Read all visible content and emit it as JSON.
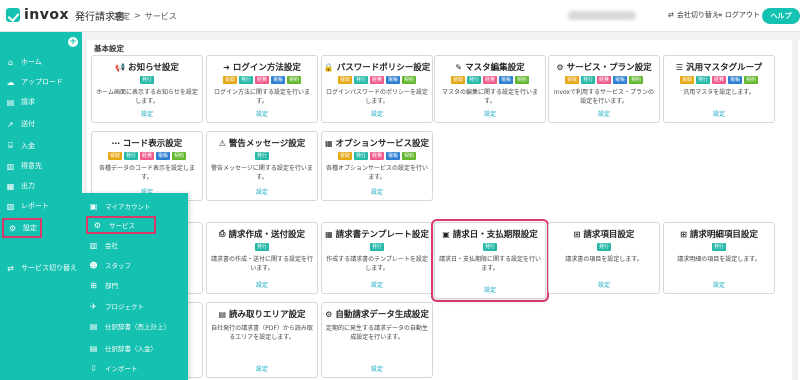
{
  "brand": {
    "name": "invox",
    "product": "発行請求書"
  },
  "breadcrumb": [
    "設定",
    ">",
    "サービス"
  ],
  "header": {
    "switch_company": "会社切り替え",
    "logout": "ログアウト",
    "help": "ヘルプ"
  },
  "colors": {
    "accent": "#15c1b0",
    "highlight": "#d9396b",
    "link": "#15a8c1"
  },
  "sidebar": {
    "items": [
      {
        "label": "ホーム",
        "icon": "home-icon"
      },
      {
        "label": "アップロード",
        "icon": "upload-icon"
      },
      {
        "label": "請求",
        "icon": "document-icon"
      },
      {
        "label": "送付",
        "icon": "send-icon"
      },
      {
        "label": "入金",
        "icon": "bank-icon"
      },
      {
        "label": "得意先",
        "icon": "building-icon"
      },
      {
        "label": "出力",
        "icon": "export-icon"
      },
      {
        "label": "レポート",
        "icon": "report-icon"
      },
      {
        "label": "設定",
        "icon": "gear-icon"
      },
      {
        "label": "サービス切り替え",
        "icon": "switch-icon"
      }
    ]
  },
  "submenu": {
    "items": [
      {
        "label": "マイアカウント",
        "icon": "account-icon"
      },
      {
        "label": "サービス",
        "icon": "gears-icon"
      },
      {
        "label": "会社",
        "icon": "company-icon"
      },
      {
        "label": "スタッフ",
        "icon": "staff-icon"
      },
      {
        "label": "部門",
        "icon": "org-icon"
      },
      {
        "label": "プロジェクト",
        "icon": "project-icon"
      },
      {
        "label": "仕訳辞書（売上計上）",
        "icon": "book-icon"
      },
      {
        "label": "仕訳辞書（入金）",
        "icon": "book-icon"
      },
      {
        "label": "インポート",
        "icon": "import-icon"
      }
    ]
  },
  "section": {
    "title": "基本設定"
  },
  "badge_labels": {
    "hakko": "発行",
    "jushin": "受取",
    "keihi": "経費",
    "denchou": "電帳",
    "keiyaku": "契約"
  },
  "cards": [
    {
      "title": "お知らせ設定",
      "icon": "megaphone-icon",
      "desc": "ホーム画面に表示するお知らせを設定します。",
      "link": "設定"
    },
    {
      "title": "ログイン方法設定",
      "icon": "login-icon",
      "desc": "ログイン方法に関する設定を行います。",
      "link": "設定"
    },
    {
      "title": "パスワードポリシー設定",
      "icon": "lock-icon",
      "desc": "ログインパスワードのポリシーを設定します。",
      "link": "設定"
    },
    {
      "title": "マスタ編集設定",
      "icon": "edit-icon",
      "desc": "マスタの編集に関する設定を行います。",
      "link": "設定"
    },
    {
      "title": "サービス・プラン設定",
      "icon": "gear-icon",
      "desc": "invoxで利用するサービス・プランの設定を行います。",
      "link": "設定"
    },
    {
      "title": "汎用マスタグループ",
      "icon": "list-icon",
      "desc": "汎用マスタを設定します。",
      "link": "設定"
    },
    {
      "title": "コード表示設定",
      "icon": "ellipsis-icon",
      "desc": "各種データのコード表示を設定します。",
      "link": "設定"
    },
    {
      "title": "警告メッセージ設定",
      "icon": "warning-icon",
      "desc": "警告メッセージに関する設定を行います。",
      "link": "設定"
    },
    {
      "title": "オプションサービス設定",
      "icon": "grid-icon",
      "desc": "各種オプションサービスの設定を行います。",
      "link": "設定"
    },
    {
      "title": "請求作成・送付設定",
      "icon": "printer-icon",
      "desc": "請求書の作成・送付に関する設定を行います。",
      "link": "設定"
    },
    {
      "title": "請求書テンプレート設定",
      "icon": "template-icon",
      "desc": "作成する請求書のテンプレートを設定します。",
      "link": "設定"
    },
    {
      "title": "請求日・支払期限設定",
      "icon": "calendar-icon",
      "desc": "請求日・支払期限に関する設定を行います。",
      "link": "設定"
    },
    {
      "title": "請求項目設定",
      "icon": "sitemap-icon",
      "desc": "請求書の項目を設定します。",
      "link": "設定"
    },
    {
      "title": "請求明細項目設定",
      "icon": "sitemap-icon",
      "desc": "請求明細の項目を設定します。",
      "link": "設定"
    },
    {
      "title": "読み取りエリア設定",
      "icon": "scan-icon",
      "desc": "自社発行の請求書（PDF）から読み取るエリアを設定します。",
      "link": "設定"
    },
    {
      "title": "自動請求データ生成設定",
      "icon": "cog-icon",
      "desc": "定期的に発生する請求データの自動生成設定を行います。",
      "link": "設定"
    }
  ]
}
